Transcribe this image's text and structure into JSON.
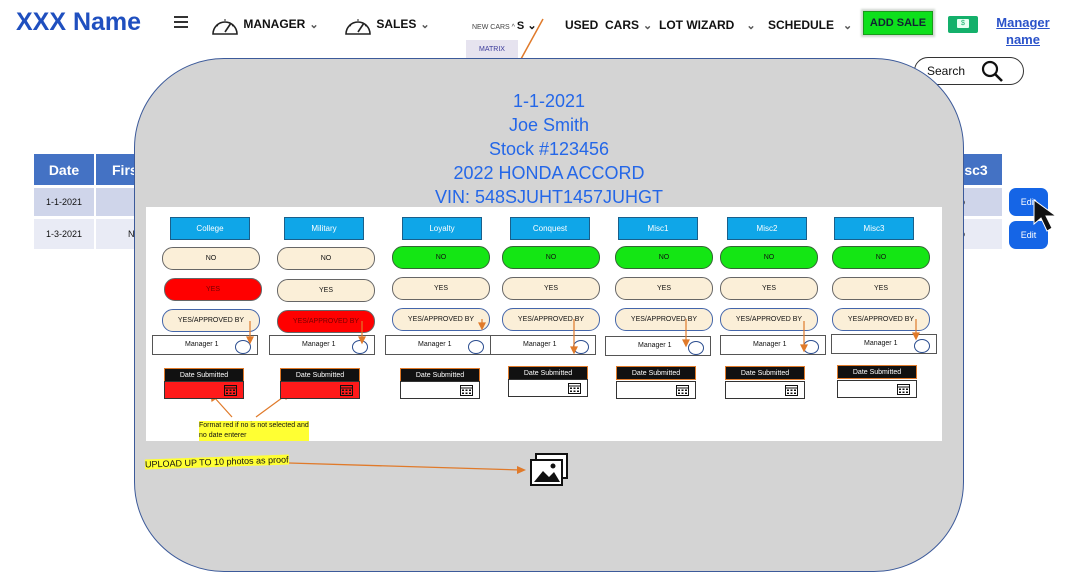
{
  "brand": "XXX Name",
  "nav": {
    "manager": "MANAGER",
    "sales": "SALES",
    "new_cars": "NEW CARS",
    "used_cars": "USED  CARS",
    "lot_wizard": "LOT WIZARD",
    "schedule": "SCHEDULE",
    "matrix": "MATRIX",
    "add_sale": "ADD SALE",
    "manager_name_1": "Manager",
    "manager_name_2": "name"
  },
  "search": {
    "label": "Search"
  },
  "table": {
    "headers": {
      "date": "Date",
      "first": "Firs",
      "misc3": "sc3"
    },
    "rows": [
      {
        "date": "1-1-2021",
        "first": "",
        "tail": "o",
        "edit": "Edit"
      },
      {
        "date": "1-3-2021",
        "first": "N",
        "tail": "o",
        "edit": "Edit"
      }
    ]
  },
  "modal": {
    "line1": "1-1-2021",
    "line2": "Joe Smith",
    "line3": "Stock #123456",
    "line4": "2022 HONDA ACCORD",
    "line5": "VIN: 548SJUHT1457JUHGT",
    "columns": [
      {
        "header": "College",
        "no": "NO",
        "yes": "YES",
        "yab": "YES/APPROVED BY",
        "manager": "Manager 1",
        "date": "Date Submitted"
      },
      {
        "header": "Military",
        "no": "NO",
        "yes": "YES",
        "yab": "YES/APPROVED BY",
        "manager": "Manager 1",
        "date": "Date Submitted"
      },
      {
        "header": "Loyalty",
        "no": "NO",
        "yes": "YES",
        "yab": "YES/APPROVED BY",
        "manager": "Manager 1",
        "date": "Date Submitted"
      },
      {
        "header": "Conquest",
        "no": "NO",
        "yes": "YES",
        "yab": "YES/APPROVED BY",
        "manager": "Manager 1",
        "date": "Date Submitted"
      },
      {
        "header": "Misc1",
        "no": "NO",
        "yes": "YES",
        "yab": "YES/APPROVED BY",
        "manager": "Manager 1",
        "date": "Date Submitted"
      },
      {
        "header": "Misc2",
        "no": "NO",
        "yes": "YES",
        "yab": "YES/APPROVED BY",
        "manager": "Manager 1",
        "date": "Date Submitted"
      },
      {
        "header": "Misc3",
        "no": "NO",
        "yes": "YES",
        "yab": "YES/APPROVED BY",
        "manager": "Manager 1",
        "date": "Date Submitted"
      }
    ],
    "note_line1": "Format red if no is not selected and",
    "note_line2": "no date enterer",
    "upload": "UPLOAD UP TO 10 photos as proof"
  },
  "colors": {
    "accent_blue": "#2467e8",
    "header_blue": "#4472c4",
    "green": "#14e614",
    "red": "#ff0000"
  }
}
